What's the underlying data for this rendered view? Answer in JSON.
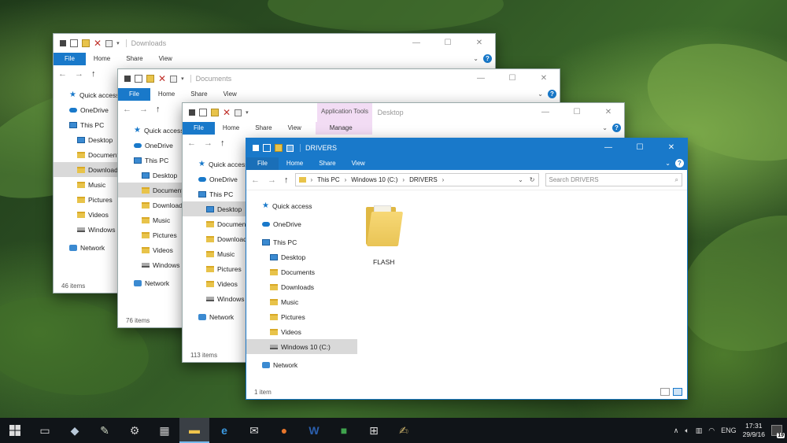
{
  "windows": {
    "downloads": {
      "title": "Downloads",
      "tabs": [
        "File",
        "Home",
        "Share",
        "View"
      ],
      "nav": [
        "Quick access",
        "OneDrive",
        "This PC",
        "Desktop",
        "Documents",
        "Downloads",
        "Music",
        "Pictures",
        "Videos",
        "Windows",
        "Network"
      ],
      "status": "46 items"
    },
    "documents": {
      "title": "Documents",
      "tabs": [
        "File",
        "Home",
        "Share",
        "View"
      ],
      "nav": [
        "Quick access",
        "OneDrive",
        "This PC",
        "Desktop",
        "Documents",
        "Downloads",
        "Music",
        "Pictures",
        "Videos",
        "Windows",
        "Network"
      ],
      "status": "76 items"
    },
    "desktop": {
      "title": "Desktop",
      "context_tab_group": "Application Tools",
      "tabs": [
        "File",
        "Home",
        "Share",
        "View",
        "Manage"
      ],
      "nav": [
        "Quick access",
        "OneDrive",
        "This PC",
        "Desktop",
        "Documents",
        "Downloads",
        "Music",
        "Pictures",
        "Videos",
        "Windows",
        "Network"
      ],
      "status": "113 items"
    },
    "drivers": {
      "title": "DRIVERS",
      "tabs": [
        "File",
        "Home",
        "Share",
        "View"
      ],
      "breadcrumb": [
        "This PC",
        "Windows 10 (C:)",
        "DRIVERS"
      ],
      "search_placeholder": "Search DRIVERS",
      "nav": [
        "Quick access",
        "OneDrive",
        "This PC",
        "Desktop",
        "Documents",
        "Downloads",
        "Music",
        "Pictures",
        "Videos",
        "Windows 10 (C:)",
        "Network"
      ],
      "items": [
        {
          "name": "FLASH",
          "icon": "folder-icon"
        }
      ],
      "status": "1 item"
    }
  },
  "taskbar": {
    "icons": [
      "start-icon",
      "task-view-icon",
      "app-icon",
      "app-icon",
      "app-icon",
      "calculator-icon",
      "file-explorer-icon",
      "edge-icon",
      "mail-icon",
      "firefox-icon",
      "word-icon",
      "app-icon",
      "store-icon",
      "app-icon"
    ],
    "language": "ENG",
    "time": "17:31",
    "date": "29/9/16",
    "notification_count": "19"
  },
  "colors": {
    "accent": "#1979ca",
    "taskbar": "#101418",
    "folder": "#e8c34a"
  }
}
